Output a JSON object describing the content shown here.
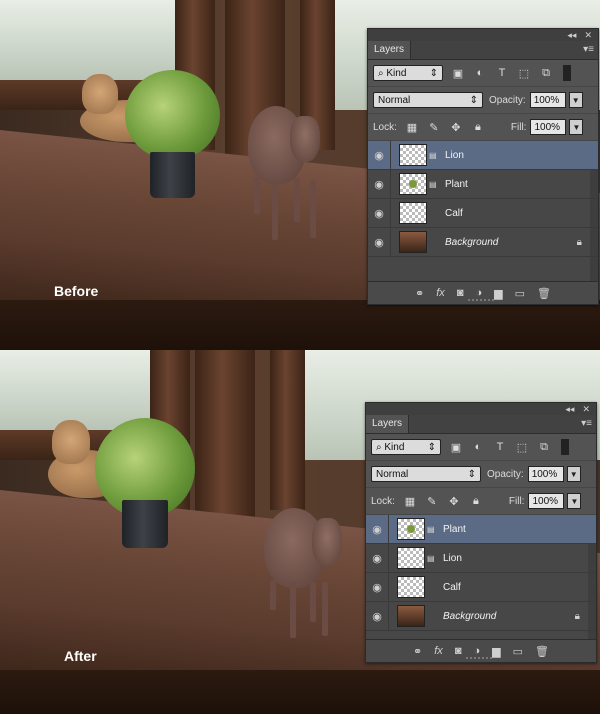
{
  "scenes": [
    {
      "caption": "Before",
      "panel": {
        "tab_label": "Layers",
        "menu_icon": "panel-menu-icon",
        "filter": {
          "search_glyph": "⌕",
          "kind_label": "Kind"
        },
        "blend_mode": "Normal",
        "opacity_label": "Opacity:",
        "opacity_value": "100%",
        "lock_label": "Lock:",
        "fill_label": "Fill:",
        "fill_value": "100%",
        "layers": [
          {
            "name": "Lion",
            "selected": true
          },
          {
            "name": "Plant",
            "selected": false
          },
          {
            "name": "Calf",
            "selected": false
          },
          {
            "name": "Background",
            "selected": false
          }
        ],
        "bottom_icons": [
          "link-layers-icon",
          "fx-icon",
          "add-mask-icon",
          "adjustment-layer-icon",
          "new-group-icon",
          "new-layer-icon",
          "delete-layer-icon"
        ],
        "fx_label": "fx"
      }
    },
    {
      "caption": "After",
      "panel": {
        "tab_label": "Layers",
        "menu_icon": "panel-menu-icon",
        "filter": {
          "search_glyph": "⌕",
          "kind_label": "Kind"
        },
        "blend_mode": "Normal",
        "opacity_label": "Opacity:",
        "opacity_value": "100%",
        "lock_label": "Lock:",
        "fill_label": "Fill:",
        "fill_value": "100%",
        "layers": [
          {
            "name": "Plant",
            "selected": true
          },
          {
            "name": "Lion",
            "selected": false
          },
          {
            "name": "Calf",
            "selected": false
          },
          {
            "name": "Background",
            "selected": false
          }
        ],
        "bottom_icons": [
          "link-layers-icon",
          "fx-icon",
          "add-mask-icon",
          "adjustment-layer-icon",
          "new-group-icon",
          "new-layer-icon",
          "delete-layer-icon"
        ],
        "fx_label": "fx"
      }
    }
  ],
  "colors": {
    "panel_bg": "#535353",
    "selected_layer": "#5b6b85"
  }
}
